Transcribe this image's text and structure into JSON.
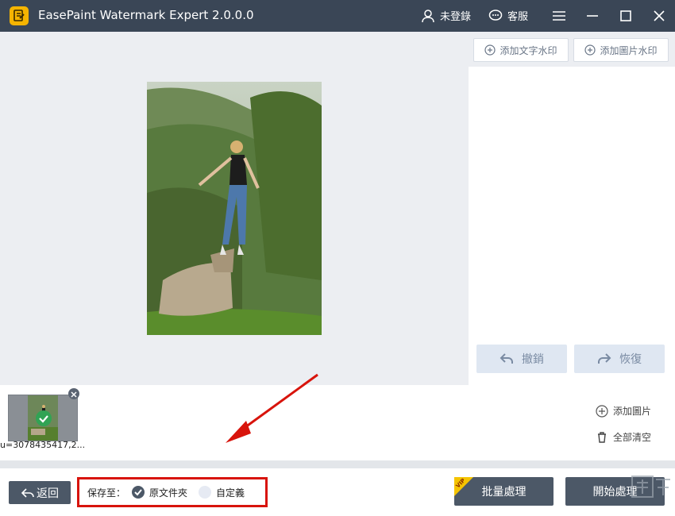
{
  "app": {
    "title": "EasePaint Watermark Expert  2.0.0.0"
  },
  "titlebar": {
    "login_label": "未登錄",
    "service_label": "客服"
  },
  "right_panel": {
    "add_text_watermark": "添加文字水印",
    "add_image_watermark": "添加圖片水印",
    "undo_label": "撤銷",
    "redo_label": "恢復"
  },
  "thumbnails": [
    {
      "filename": "u=3078435417,2..."
    }
  ],
  "side_actions": {
    "add_image": "添加圖片",
    "clear_all": "全部清空"
  },
  "bottom": {
    "back_label": "返回",
    "save_to_label": "保存至：",
    "option_original": "原文件夾",
    "option_custom": "自定義",
    "selected_option": "原文件夾",
    "batch_label": "批量處理",
    "vip_badge": "VIP",
    "start_label": "開始處理"
  },
  "colors": {
    "titlebar": "#3a4656",
    "accent_dark": "#4c5867",
    "highlight_box": "#d8140c",
    "disabled_button": "#dfe7f2",
    "check_green": "#31a354",
    "vip_yellow": "#f5c400"
  }
}
